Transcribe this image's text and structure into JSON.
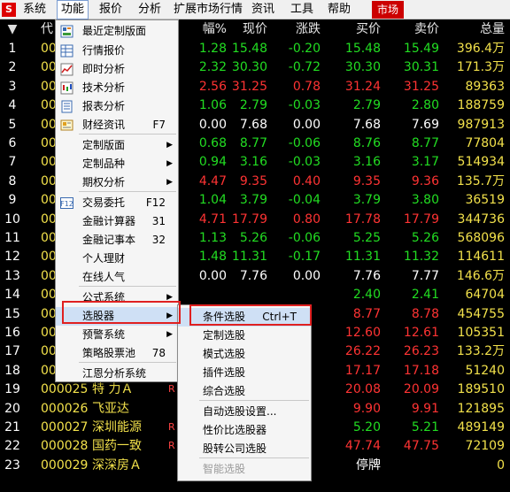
{
  "menubar": {
    "logo": "S",
    "items": [
      "系统",
      "功能",
      "报价",
      "分析",
      "扩展市场行情",
      "资讯",
      "工具",
      "帮助"
    ],
    "market": "市场"
  },
  "grid": {
    "headers": {
      "idx": "▼",
      "code": "代",
      "pct": "幅%",
      "price": "现价",
      "chg": "涨跌",
      "bid": "买价",
      "ask": "卖价",
      "vol": "总量"
    },
    "rows": [
      {
        "idx": "1",
        "code": "00",
        "name": "",
        "flag": "",
        "pct": "1.28",
        "price": "15.48",
        "chg": "-0.20",
        "bid": "15.48",
        "ask": "15.49",
        "vol": "396.4万",
        "dir": "dn"
      },
      {
        "idx": "2",
        "code": "00",
        "name": "",
        "flag": "",
        "pct": "2.32",
        "price": "30.30",
        "chg": "-0.72",
        "bid": "30.30",
        "ask": "30.31",
        "vol": "171.3万",
        "dir": "dn"
      },
      {
        "idx": "3",
        "code": "00",
        "name": "",
        "flag": "",
        "pct": "2.56",
        "price": "31.25",
        "chg": "0.78",
        "bid": "31.24",
        "ask": "31.25",
        "vol": "89363",
        "dir": "up"
      },
      {
        "idx": "4",
        "code": "00",
        "name": "",
        "flag": "",
        "pct": "1.06",
        "price": "2.79",
        "chg": "-0.03",
        "bid": "2.79",
        "ask": "2.80",
        "vol": "188759",
        "dir": "dn"
      },
      {
        "idx": "5",
        "code": "00",
        "name": "",
        "flag": "",
        "pct": "0.00",
        "price": "7.68",
        "chg": "0.00",
        "bid": "7.68",
        "ask": "7.69",
        "vol": "987913",
        "dir": "eq"
      },
      {
        "idx": "6",
        "code": "00",
        "name": "",
        "flag": "",
        "pct": "0.68",
        "price": "8.77",
        "chg": "-0.06",
        "bid": "8.76",
        "ask": "8.77",
        "vol": "77804",
        "dir": "dn"
      },
      {
        "idx": "7",
        "code": "00",
        "name": "",
        "flag": "",
        "pct": "0.94",
        "price": "3.16",
        "chg": "-0.03",
        "bid": "3.16",
        "ask": "3.17",
        "vol": "514934",
        "dir": "dn"
      },
      {
        "idx": "8",
        "code": "00",
        "name": "",
        "flag": "",
        "pct": "4.47",
        "price": "9.35",
        "chg": "0.40",
        "bid": "9.35",
        "ask": "9.36",
        "vol": "135.7万",
        "dir": "up"
      },
      {
        "idx": "9",
        "code": "00",
        "name": "",
        "flag": "",
        "pct": "1.04",
        "price": "3.79",
        "chg": "-0.04",
        "bid": "3.79",
        "ask": "3.80",
        "vol": "36519",
        "dir": "dn"
      },
      {
        "idx": "10",
        "code": "00",
        "name": "",
        "flag": "",
        "pct": "4.71",
        "price": "17.79",
        "chg": "0.80",
        "bid": "17.78",
        "ask": "17.79",
        "vol": "344736",
        "dir": "up"
      },
      {
        "idx": "11",
        "code": "00",
        "name": "",
        "flag": "",
        "pct": "1.13",
        "price": "5.26",
        "chg": "-0.06",
        "bid": "5.25",
        "ask": "5.26",
        "vol": "568096",
        "dir": "dn"
      },
      {
        "idx": "12",
        "code": "00",
        "name": "",
        "flag": "",
        "pct": "1.48",
        "price": "11.31",
        "chg": "-0.17",
        "bid": "11.31",
        "ask": "11.32",
        "vol": "114611",
        "dir": "dn"
      },
      {
        "idx": "13",
        "code": "00",
        "name": "",
        "flag": "",
        "pct": "0.00",
        "price": "7.76",
        "chg": "0.00",
        "bid": "7.76",
        "ask": "7.77",
        "vol": "146.6万",
        "dir": "eq"
      },
      {
        "idx": "14",
        "code": "00",
        "name": "",
        "flag": "",
        "pct": "",
        "price": "",
        "chg": "",
        "bid": "2.40",
        "ask": "2.41",
        "vol": "64704",
        "dir": "dn"
      },
      {
        "idx": "15",
        "code": "00",
        "name": "",
        "flag": "",
        "pct": "",
        "price": "",
        "chg": "",
        "bid": "8.77",
        "ask": "8.78",
        "vol": "454755",
        "dir": "up"
      },
      {
        "idx": "16",
        "code": "00",
        "name": "",
        "flag": "",
        "pct": "",
        "price": "",
        "chg": "",
        "bid": "12.60",
        "ask": "12.61",
        "vol": "105351",
        "dir": "up"
      },
      {
        "idx": "17",
        "code": "00",
        "name": "",
        "flag": "",
        "pct": "",
        "price": "",
        "chg": "",
        "bid": "26.22",
        "ask": "26.23",
        "vol": "133.2万",
        "dir": "up"
      },
      {
        "idx": "18",
        "code": "00",
        "name": "",
        "flag": "",
        "pct": "",
        "price": "",
        "chg": "",
        "bid": "17.17",
        "ask": "17.18",
        "vol": "51240",
        "dir": "up"
      },
      {
        "idx": "19",
        "code": "000025",
        "name": "特 力Ａ",
        "flag": "R",
        "pct": "",
        "price": "",
        "chg": "",
        "bid": "20.08",
        "ask": "20.09",
        "vol": "189510",
        "dir": "up"
      },
      {
        "idx": "20",
        "code": "000026",
        "name": "飞亚达",
        "flag": "",
        "pct": "",
        "price": "",
        "chg": "",
        "bid": "9.90",
        "ask": "9.91",
        "vol": "121895",
        "dir": "up"
      },
      {
        "idx": "21",
        "code": "000027",
        "name": "深圳能源",
        "flag": "R",
        "pct": "",
        "price": "",
        "chg": "",
        "bid": "5.20",
        "ask": "5.21",
        "vol": "489149",
        "dir": "dn"
      },
      {
        "idx": "22",
        "code": "000028",
        "name": "国药一致",
        "flag": "R",
        "pct": "",
        "price": "",
        "chg": "",
        "bid": "47.74",
        "ask": "47.75",
        "vol": "72109",
        "dir": "up"
      },
      {
        "idx": "23",
        "code": "000029",
        "name": "深深房Ａ",
        "flag": "",
        "pct": "",
        "price": "",
        "chg": "",
        "bid": "停牌",
        "ask": "",
        "vol": "0",
        "dir": "eq"
      }
    ]
  },
  "func_menu": {
    "items": [
      {
        "label": "最近定制版面",
        "shortcut": "",
        "arrow": false,
        "icon": "layout-icon"
      },
      {
        "label": "行情报价",
        "shortcut": "",
        "arrow": false,
        "icon": "quote-table-icon"
      },
      {
        "label": "即时分析",
        "shortcut": "",
        "arrow": false,
        "icon": "line-chart-icon"
      },
      {
        "label": "技术分析",
        "shortcut": "",
        "arrow": false,
        "icon": "candlestick-icon"
      },
      {
        "label": "报表分析",
        "shortcut": "",
        "arrow": false,
        "icon": "report-icon"
      },
      {
        "label": "财经资讯",
        "shortcut": "F7",
        "arrow": false,
        "icon": "news-icon"
      },
      {
        "label": "定制版面",
        "shortcut": "",
        "arrow": true,
        "icon": ""
      },
      {
        "label": "定制品种",
        "shortcut": "",
        "arrow": true,
        "icon": ""
      },
      {
        "label": "期权分析",
        "shortcut": "",
        "arrow": true,
        "icon": ""
      },
      {
        "label": "交易委托",
        "shortcut": "F12",
        "arrow": false,
        "icon": "f12-icon"
      },
      {
        "label": "金融计算器",
        "shortcut": "31",
        "arrow": false,
        "icon": ""
      },
      {
        "label": "金融记事本",
        "shortcut": "32",
        "arrow": false,
        "icon": ""
      },
      {
        "label": "个人理财",
        "shortcut": "",
        "arrow": false,
        "icon": ""
      },
      {
        "label": "在线人气",
        "shortcut": "",
        "arrow": false,
        "icon": ""
      },
      {
        "label": "公式系统",
        "shortcut": "",
        "arrow": true,
        "icon": ""
      },
      {
        "label": "选股器",
        "shortcut": "",
        "arrow": true,
        "icon": ""
      },
      {
        "label": "预警系统",
        "shortcut": "",
        "arrow": true,
        "icon": ""
      },
      {
        "label": "策略股票池",
        "shortcut": "78",
        "arrow": false,
        "icon": ""
      },
      {
        "label": "江恩分析系统",
        "shortcut": "",
        "arrow": false,
        "icon": ""
      }
    ]
  },
  "picker_menu": {
    "items": [
      {
        "label": "条件选股",
        "shortcut": "Ctrl+T",
        "disabled": false
      },
      {
        "label": "定制选股",
        "shortcut": "",
        "disabled": false
      },
      {
        "label": "模式选股",
        "shortcut": "",
        "disabled": false
      },
      {
        "label": "插件选股",
        "shortcut": "",
        "disabled": false
      },
      {
        "label": "综合选股",
        "shortcut": "",
        "disabled": false
      },
      {
        "label": "自动选股设置...",
        "shortcut": "",
        "disabled": false
      },
      {
        "label": "性价比选股器",
        "shortcut": "",
        "disabled": false
      },
      {
        "label": "股转公司选股",
        "shortcut": "",
        "disabled": false
      },
      {
        "label": "智能选股",
        "shortcut": "",
        "disabled": true
      }
    ]
  },
  "colors": {
    "up": "#ff3333",
    "down": "#22dd22",
    "highlight": "#e02020",
    "market": "#cc0000"
  }
}
